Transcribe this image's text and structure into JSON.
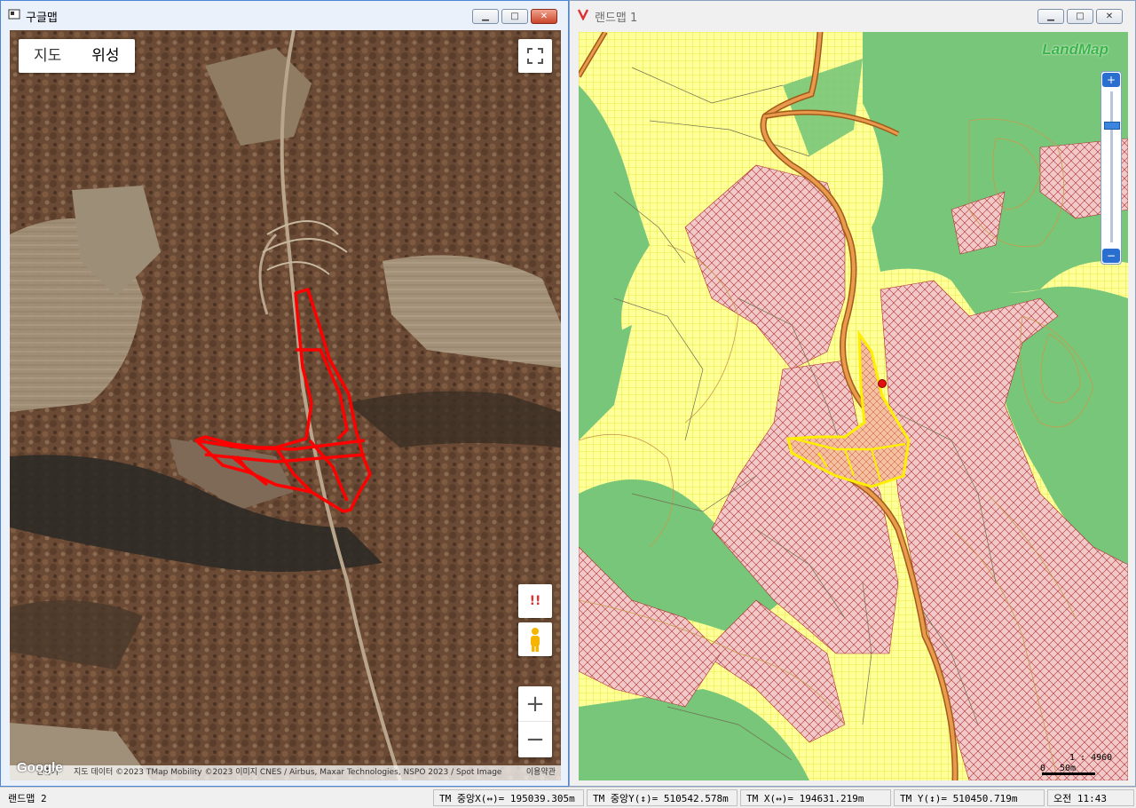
{
  "google_window": {
    "title": "구글맵",
    "map_type": {
      "map_label": "지도",
      "satellite_label": "위성"
    },
    "attribution": {
      "shortcut": "단축키",
      "data": "지도 데이터 ©2023 TMap Mobility ©2023 이미지 CNES / Airbus, Maxar Technologies, NSPO 2023 / Spot Image",
      "terms": "이용약관"
    },
    "logo": "Google",
    "controls": {
      "report": "!!",
      "zoom_in": "+",
      "zoom_out": "−"
    }
  },
  "landmap_window": {
    "title": "랜드맵 1",
    "logo": "LandMap",
    "scale": {
      "ratio": "1 : 4960",
      "zero": "0",
      "distance": "50m"
    }
  },
  "statusbar": {
    "window_name": "랜드맵 2",
    "tm_center_x": "TM 중앙X(↔)= 195039.305m",
    "tm_center_y": "TM 중앙Y(↕)= 510542.578m",
    "tm_x": "TM X(↔)= 194631.219m",
    "tm_y": "TM Y(↕)= 510450.719m",
    "time": "오전 11:43"
  },
  "colors": {
    "accent": "#4d86d6",
    "forest_green": "#78c67a",
    "field_yellow": "#ffff99",
    "restricted_red": "#b03030",
    "road_orange": "#e99a4c",
    "parcel_outline": "#ff0000"
  }
}
